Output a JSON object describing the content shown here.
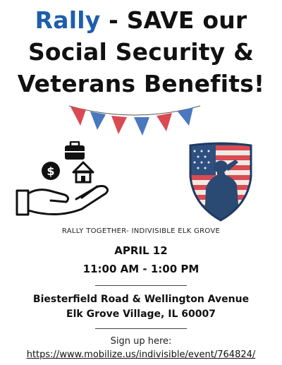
{
  "headline": {
    "rally": "Rally",
    "line1_rest": " - SAVE our",
    "line2": "Social Security &",
    "line3": "Veterans Benefits!"
  },
  "subtitle": "RALLY TOGETHER- INDIVISIBLE ELK GROVE",
  "event": {
    "date": "APRIL 12",
    "time": "11:00 AM - 1:00 PM"
  },
  "location": {
    "street": "Biesterfield Road & Wellington Avenue",
    "city": "Elk Grove Village, IL 60007"
  },
  "signup": {
    "label": "Sign up here:",
    "url": "https://www.mobilize.us/indivisible/event/764824/"
  },
  "colors": {
    "rally_blue": "#1f5eab",
    "flag_red": "#d94a52",
    "flag_blue": "#4a78bf"
  },
  "icons": [
    "bunting-icon",
    "money-hand-icon",
    "briefcase-icon",
    "house-icon",
    "dollar-icon",
    "veteran-shield-icon"
  ]
}
